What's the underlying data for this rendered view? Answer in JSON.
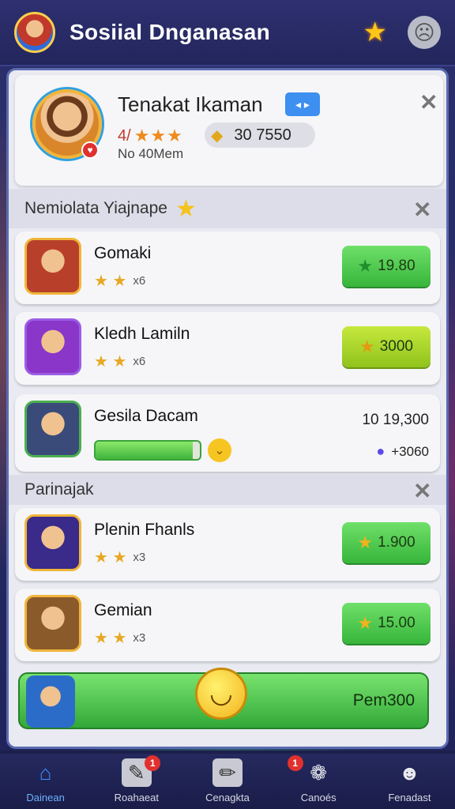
{
  "header": {
    "title": "Sosiial Dnganasan",
    "star_icon": "star-icon",
    "profile_icon": "sad-face-icon"
  },
  "profile_card": {
    "name": "Tenakat Ikaman",
    "tag_label": "◂ ▸",
    "rating_text": "4/",
    "stars_text": "★★★",
    "coins": "30 7550",
    "subtitle": "No 40Mem"
  },
  "section_1": {
    "title": "Nemiolata Yiajnape",
    "items": [
      {
        "name": "Gomaki",
        "stars": "★ ★",
        "rank": "x6",
        "price": "19.80",
        "button_color": "green"
      },
      {
        "name": "Kledh Lamiln",
        "stars": "★ ★",
        "rank": "x6",
        "price": "3000",
        "button_color": "yellow"
      }
    ],
    "progress_item": {
      "name": "Gesila Dacam",
      "value_top": "10 19,300",
      "value_bottom": "+3060",
      "progress": 0.93
    }
  },
  "section_2": {
    "title": "Parinajak",
    "items": [
      {
        "name": "Plenin Fhanls",
        "stars": "★ ★",
        "rank": "x3",
        "price": "1.900",
        "button_color": "green"
      },
      {
        "name": "Gemian",
        "stars": "★ ★",
        "rank": "x3",
        "price": "15.00",
        "button_color": "green"
      }
    ]
  },
  "claim_bar": {
    "label": "Pem300"
  },
  "bottom_nav": [
    {
      "label": "Dainean",
      "icon": "home-icon",
      "active": true,
      "badge": ""
    },
    {
      "label": "Roahaeat",
      "icon": "edit-icon",
      "active": false,
      "badge": "1"
    },
    {
      "label": "Cenagkta",
      "icon": "pencil-icon",
      "active": false,
      "badge": ""
    },
    {
      "label": "Canoés",
      "icon": "group-icon",
      "active": false,
      "badge": "1"
    },
    {
      "label": "Fenadast",
      "icon": "user-icon",
      "active": false,
      "badge": ""
    }
  ],
  "colors": {
    "header_bg": "#23265c",
    "accent_green": "#37b53a",
    "accent_yellow": "#8fc31c",
    "nav_active": "#3b8fff"
  }
}
